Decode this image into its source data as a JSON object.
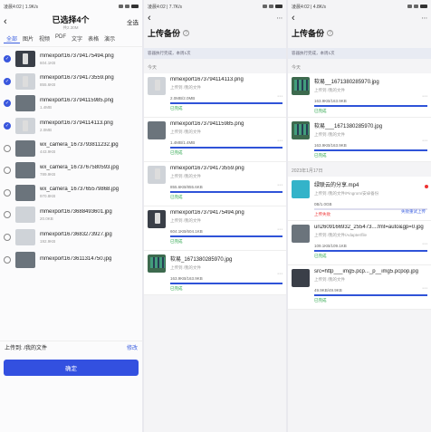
{
  "status_bars": [
    {
      "left": "凌晨4:02 | 1.9K/s"
    },
    {
      "left": "凌晨4:02 | 7.7K/s"
    },
    {
      "left": "凌晨4:02 | 4.8K/s"
    }
  ],
  "select": {
    "title": "已选择4个",
    "subtitle": "共2.30M",
    "select_all": "全选",
    "tabs": [
      "全部",
      "图片",
      "视频",
      "PDF",
      "文字",
      "表格",
      "演示"
    ],
    "files": [
      {
        "name": "mmexport1673794175494.png",
        "size": "604.1KB",
        "checked": true,
        "thumb": "dark phone"
      },
      {
        "name": "mmexport1673794173559.png",
        "size": "855.6KB",
        "checked": true,
        "thumb": "light phone"
      },
      {
        "name": "mmexport1673794115985.png",
        "size": "1.4MB",
        "checked": true,
        "thumb": "photo"
      },
      {
        "name": "mmexport1673794114113.png",
        "size": "2.0MB",
        "checked": true,
        "thumb": "light phone"
      },
      {
        "name": "wx_camera_1673793811232.jpg",
        "size": "443.9KB",
        "checked": false,
        "thumb": "photo"
      },
      {
        "name": "wx_camera_1673767580593.jpg",
        "size": "789.9KB",
        "checked": false,
        "thumb": "photo"
      },
      {
        "name": "wx_camera_1673765579868.jpg",
        "size": "970.8KB",
        "checked": false,
        "thumb": "photo"
      },
      {
        "name": "mmexport1673688493601.jpg",
        "size": "20.0KB",
        "checked": false,
        "thumb": "light"
      },
      {
        "name": "mmexport1673683273927.jpg",
        "size": "192.9KB",
        "checked": false,
        "thumb": "light"
      },
      {
        "name": "mmexport1673611314750.jpg",
        "size": "",
        "checked": false,
        "thumb": "photo"
      }
    ],
    "upload_to_label": "上传到: /我的文件",
    "change_label": "修改",
    "confirm_label": "确定"
  },
  "upload_a": {
    "title": "上传备份",
    "notice": "容器执行完成，本周1次",
    "section": "今天",
    "items": [
      {
        "name": "mmexport1673794114113.png",
        "sub": "上传到 /我的文件",
        "size": "2.0MB/2.0MB",
        "status": "已完成",
        "thumb": "light phone",
        "progress": 1.0
      },
      {
        "name": "mmexport1673794115985.png",
        "sub": "上传到 /我的文件",
        "size": "1.4MB/1.4MB",
        "status": "已完成",
        "thumb": "photo",
        "progress": 1.0
      },
      {
        "name": "mmexport1673794173559.png",
        "sub": "上传到 /我的文件",
        "size": "855.6KB/855.6KB",
        "status": "已完成",
        "thumb": "light phone",
        "progress": 1.0
      },
      {
        "name": "mmexport1673794175494.png",
        "sub": "上传到 /我的文件",
        "size": "604.1KB/604.1KB",
        "status": "已完成",
        "thumb": "dark phone",
        "progress": 1.0
      },
      {
        "name": "软易_1671380285970.jpg",
        "sub": "上传到 /我的文件",
        "size": "163.9KB/163.9KB",
        "status": "已完成",
        "thumb": "green grid",
        "progress": 1.0
      }
    ]
  },
  "upload_b": {
    "title": "上传备份",
    "notice": "容器执行完成，本周1次",
    "section_today": "今天",
    "today_items": [
      {
        "name": "软易__1671380285970.jpg",
        "sub": "上传到 /我的文件",
        "size": "163.9KB/163.9KB",
        "status": "已完成",
        "thumb": "green grid",
        "progress": 1.0
      },
      {
        "name": "软易___1671380285970.jpg",
        "sub": "上传到 /我的文件",
        "size": "163.9KB/163.9KB",
        "status": "已完成",
        "thumb": "green grid",
        "progress": 1.0
      }
    ],
    "section_date": "2023年1月17日",
    "date_items": [
      {
        "name": "绿联云的分享.mp4",
        "sub": "上传到 /我的文件/Pingrom/安卓备份",
        "size": "0B/1.0GB",
        "status": "上传失败",
        "retry": "失败重试上传",
        "thumb": "cyan",
        "progress": 0.0,
        "failed": true
      },
      {
        "name": "un2609166932_255473....fmt=auto&gp=0.jpg",
        "sub": "上传到 /我的文件/Adapter/file",
        "size": "109.1KB/109.1KB",
        "status": "已完成",
        "thumb": "photo",
        "progress": 1.0
      },
      {
        "name": "src=http___img5.pcp..._p__img5.pcpop.jpg",
        "sub": "上传到 /我的文件",
        "size": "49.9KB/49.9KB",
        "status": "已完成",
        "thumb": "dark",
        "progress": 1.0
      }
    ]
  }
}
